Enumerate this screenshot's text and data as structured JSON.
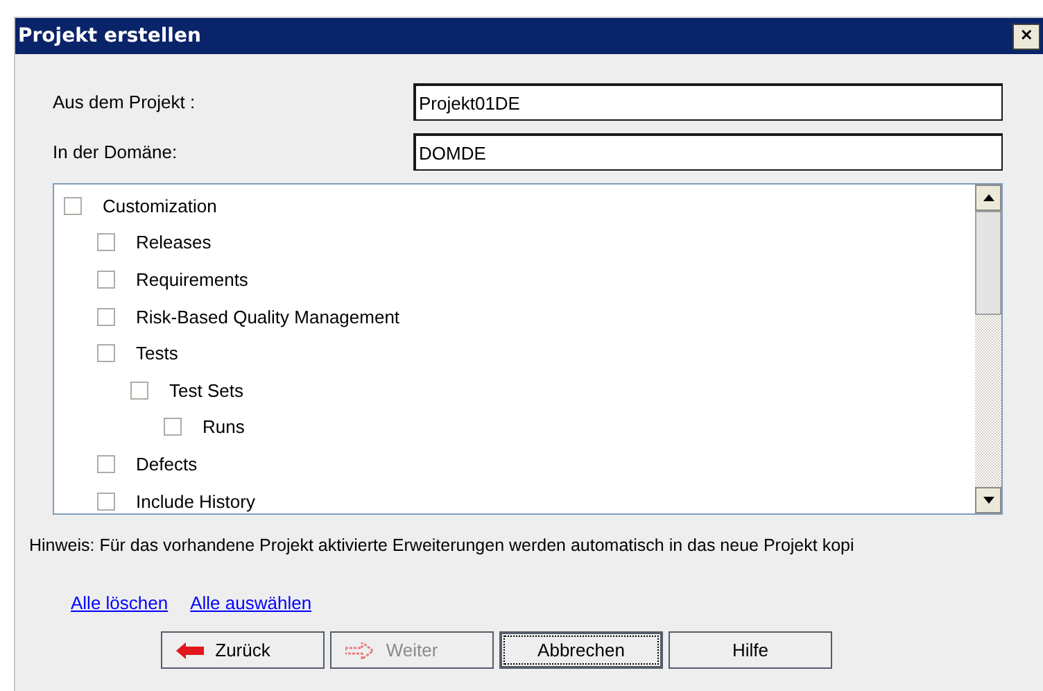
{
  "window": {
    "title": "Projekt erstellen",
    "close": "✕"
  },
  "fields": [
    {
      "label": "Aus dem Projekt :",
      "value": "Projekt01DE"
    },
    {
      "label": "In der Domäne:",
      "value": "DOMDE"
    }
  ],
  "tree": [
    {
      "label": "Customization",
      "checked": false,
      "children": [
        {
          "label": "Releases",
          "checked": false
        },
        {
          "label": "Requirements",
          "checked": false
        },
        {
          "label": "Risk-Based Quality Management",
          "checked": false
        },
        {
          "label": "Tests",
          "checked": false,
          "children": [
            {
              "label": "Test Sets",
              "checked": false,
              "children": [
                {
                  "label": "Runs",
                  "checked": false
                }
              ]
            }
          ]
        },
        {
          "label": "Defects",
          "checked": false
        },
        {
          "label": "Include History",
          "checked": false
        }
      ]
    }
  ],
  "hint": "Hinweis: Für das vorhandene Projekt aktivierte Erweiterungen werden automatisch in das neue Projekt kopi",
  "links": [
    "Alle löschen",
    "Alle auswählen"
  ],
  "buttons": [
    {
      "label": "Zurück",
      "kind": "back",
      "disabled": false,
      "focused": false
    },
    {
      "label": "Weiter",
      "kind": "next",
      "disabled": true,
      "focused": false
    },
    {
      "label": "Abbrechen",
      "kind": "plain",
      "disabled": false,
      "focused": true
    },
    {
      "label": "Hilfe",
      "kind": "plain",
      "disabled": false,
      "focused": false
    }
  ]
}
